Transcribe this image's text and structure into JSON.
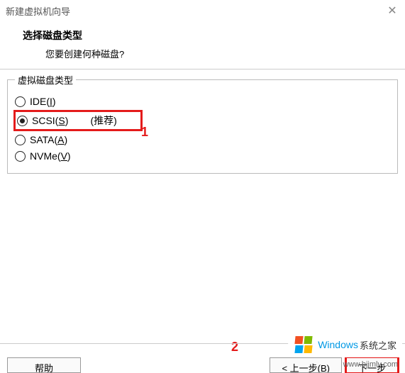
{
  "window": {
    "title": "新建虚拟机向导"
  },
  "header": {
    "title": "选择磁盘类型",
    "subtitle": "您要创建何种磁盘?"
  },
  "fieldset": {
    "legend": "虚拟磁盘类型",
    "options": {
      "ide": {
        "prefix": "IDE(",
        "hotkey": "I",
        "suffix": ")"
      },
      "scsi": {
        "prefix": "SCSI(",
        "hotkey": "S",
        "suffix": ")        (推荐)"
      },
      "sata": {
        "prefix": "SATA(",
        "hotkey": "A",
        "suffix": ")"
      },
      "nvme": {
        "prefix": "NVMe(",
        "hotkey": "V",
        "suffix": ")"
      }
    }
  },
  "annotations": {
    "a1": "1",
    "a2": "2"
  },
  "buttons": {
    "help": "帮助",
    "back": "< 上一步(B)",
    "next": "下一步"
  },
  "watermark": {
    "brand": "Windows",
    "cn": "系统之家",
    "url": "www.bjjmlv.com"
  }
}
